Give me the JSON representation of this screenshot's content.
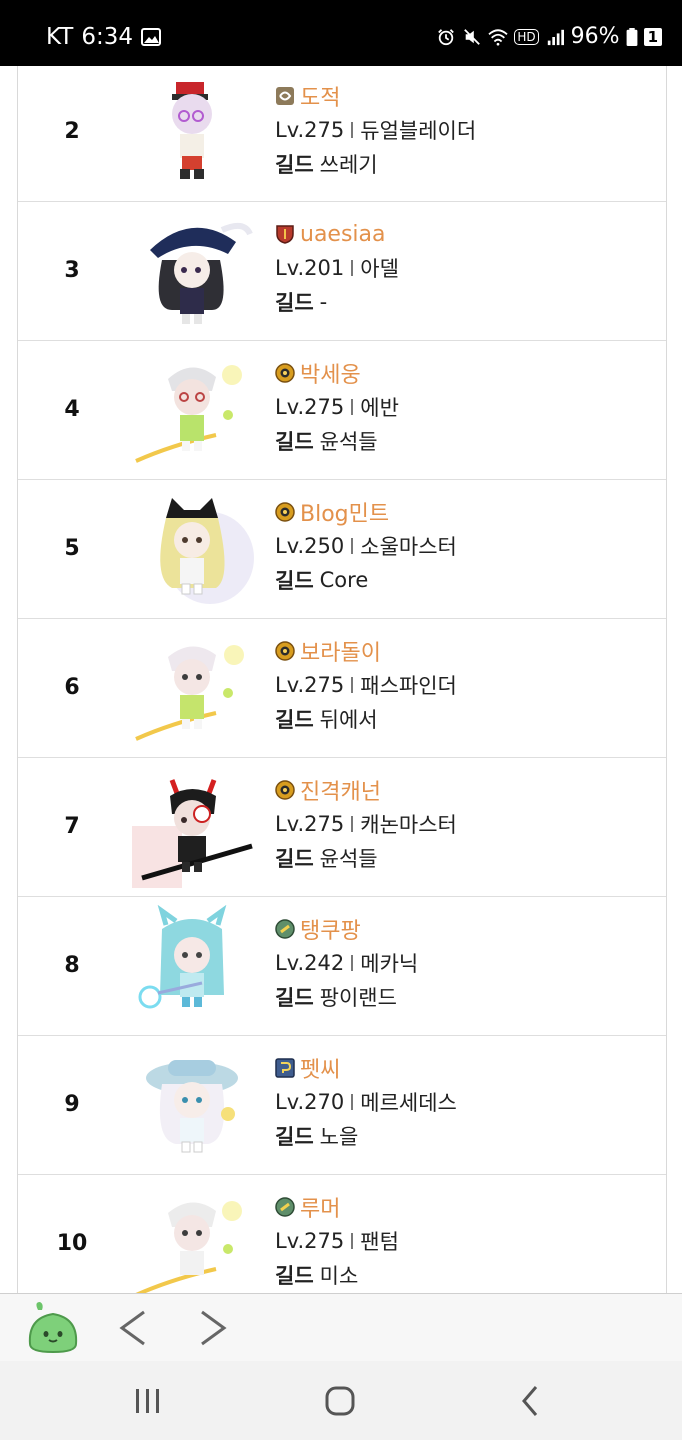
{
  "status": {
    "carrier": "KT",
    "time": "6:34",
    "hd": "HD",
    "battery": "96%",
    "sim": "1"
  },
  "rows": [
    {
      "rank": "2",
      "name": "도적",
      "level": "Lv.275",
      "job": "듀얼블레이더",
      "guild_label": "길드",
      "guild": "쓰레기",
      "job_icon": "thief-emblem-icon"
    },
    {
      "rank": "3",
      "name": "uaesiaa",
      "level": "Lv.201",
      "job": "아델",
      "guild_label": "길드",
      "guild": "-",
      "job_icon": "shield-emblem-icon"
    },
    {
      "rank": "4",
      "name": "박세웅",
      "level": "Lv.275",
      "job": "에반",
      "guild_label": "길드",
      "guild": "윤석들",
      "job_icon": "gold-coin-icon"
    },
    {
      "rank": "5",
      "name": "Blog민트",
      "level": "Lv.250",
      "job": "소울마스터",
      "guild_label": "길드",
      "guild": "Core",
      "job_icon": "gold-coin-icon"
    },
    {
      "rank": "6",
      "name": "보라돌이",
      "level": "Lv.275",
      "job": "패스파인더",
      "guild_label": "길드",
      "guild": "뒤에서",
      "job_icon": "gold-coin-icon"
    },
    {
      "rank": "7",
      "name": "진격캐넌",
      "level": "Lv.275",
      "job": "캐논마스터",
      "guild_label": "길드",
      "guild": "윤석들",
      "job_icon": "gold-coin-icon"
    },
    {
      "rank": "8",
      "name": "탱쿠팡",
      "level": "Lv.242",
      "job": "메카닉",
      "guild_label": "길드",
      "guild": "팡이랜드",
      "job_icon": "green-orb-icon"
    },
    {
      "rank": "9",
      "name": "펫씨",
      "level": "Lv.270",
      "job": "메르세데스",
      "guild_label": "길드",
      "guild": "노을",
      "job_icon": "blue-emblem-icon"
    },
    {
      "rank": "10",
      "name": "루머",
      "level": "Lv.275",
      "job": "팬텀",
      "guild_label": "길드",
      "guild": "미소",
      "job_icon": "green-orb-icon"
    }
  ],
  "colors": {
    "name": "#e3914b",
    "status_bar": "#000000",
    "browser_bar": "#f7f7f7",
    "system_nav": "#f2f2f2"
  }
}
